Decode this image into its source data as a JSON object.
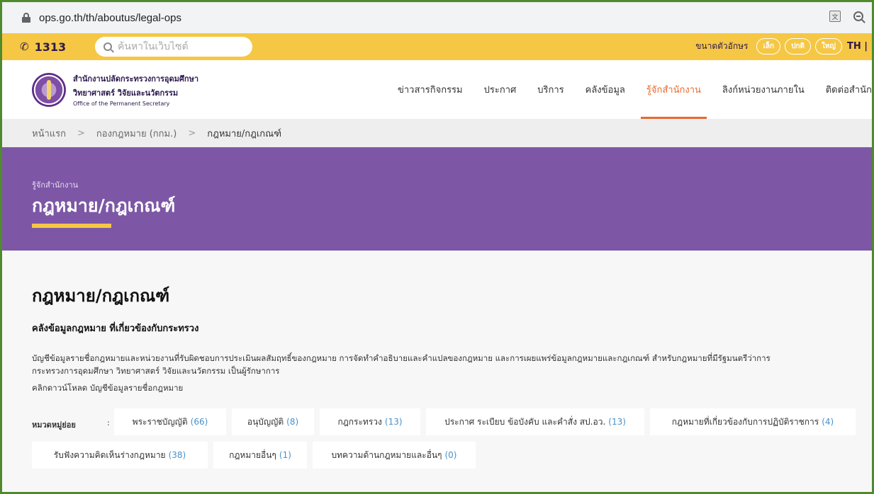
{
  "browser": {
    "url": "ops.go.th/th/aboutus/legal-ops",
    "icons": [
      "lock-icon",
      "translate-icon",
      "zoom-icon"
    ]
  },
  "topbar": {
    "hotline": "1313",
    "search_placeholder": "ค้นหาในเว็บไซต์",
    "font_size_label": "ขนาดตัวอักษร",
    "font_sizes": [
      "เล็ก",
      "ปกติ",
      "ใหญ่"
    ],
    "language": "TH |"
  },
  "header": {
    "org_name_th_1": "สำนักงานปลัดกระทรวงการอุดมศึกษา",
    "org_name_th_2": "วิทยาศาสตร์ วิจัยและนวัตกรรม",
    "org_name_en": "Office of the Permanent Secretary",
    "nav": [
      {
        "label": "ข่าวสารกิจกรรม"
      },
      {
        "label": "ประกาศ"
      },
      {
        "label": "บริการ"
      },
      {
        "label": "คลังข้อมูล"
      },
      {
        "label": "รู้จักสำนักงาน",
        "active": true
      },
      {
        "label": "ลิงก์หน่วยงานภายใน"
      },
      {
        "label": "ติดต่อสำนัก"
      }
    ]
  },
  "breadcrumb": {
    "home": "หน้าแรก",
    "sep": ">",
    "level2": "กองกฎหมาย (กกม.)",
    "current": "กฎหมาย/กฎเกณฑ์"
  },
  "banner": {
    "kicker": "รู้จักสำนักงาน",
    "title": "กฎหมาย/กฎเกณฑ์"
  },
  "content": {
    "page_title": "กฎหมาย/กฎเกณฑ์",
    "section_title": "คลังข้อมูลกฎหมาย ที่เกี่ยวข้องกับกระทรวง",
    "description_line1": "บัญชีข้อมูลรายชื่อกฎหมายและหน่วยงานที่รับผิดชอบการประเมินผลสัมฤทธิ์ของกฎหมาย การจัดทำคำอธิบายและคำแปลของกฎหมาย และการเผยแพร่ข้อมูลกฎหมายและกฎเกณฑ์ สำหรับกฎหมายที่มีรัฐมนตรีว่าการ",
    "description_line2": "กระทรวงการอุดมศึกษา วิทยาศาสตร์ วิจัยและนวัตกรรม เป็นผู้รักษาการ",
    "download_text": "คลิกดาวน์โหลด บัญชีข้อมูลรายชื่อกฎหมาย",
    "categories_label": "หมวดหมู่ย่อย",
    "categories_colon": ":",
    "categories": [
      {
        "label": "พระราชบัญญัติ",
        "count": "(66)"
      },
      {
        "label": "อนุบัญญัติ",
        "count": "(8)"
      },
      {
        "label": "กฎกระทรวง",
        "count": "(13)"
      },
      {
        "label": "ประกาศ ระเบียบ ข้อบังคับ และคำสั่ง สป.อว.",
        "count": "(13)"
      },
      {
        "label": "กฎหมายที่เกี่ยวข้องกับการปฏิบัติราชการ",
        "count": "(4)"
      },
      {
        "label": "รับฟังความคิดเห็นร่างกฎหมาย",
        "count": "(38)"
      },
      {
        "label": "กฎหมายอื่นๆ",
        "count": "(1)"
      },
      {
        "label": "บทความด้านกฎหมายและอื่นๆ",
        "count": "(0)"
      }
    ]
  },
  "colors": {
    "topbar": "#f6c744",
    "banner": "#7d57a6",
    "accent_active": "#e8692d",
    "count_link": "#4a90c8"
  }
}
